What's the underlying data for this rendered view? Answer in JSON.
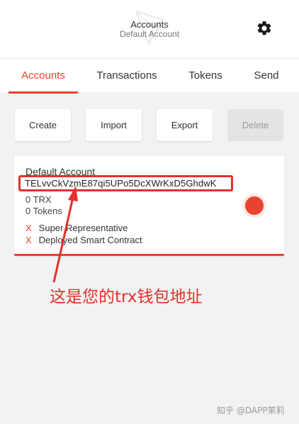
{
  "header": {
    "title": "Accounts",
    "subtitle": "Default Account",
    "settings_icon": "gear-icon"
  },
  "tabs": [
    {
      "label": "Accounts",
      "active": true
    },
    {
      "label": "Transactions",
      "active": false
    },
    {
      "label": "Tokens",
      "active": false
    },
    {
      "label": "Send",
      "active": false
    }
  ],
  "actions": {
    "create": "Create",
    "import": "Import",
    "export": "Export",
    "delete": "Delete"
  },
  "account": {
    "name": "Default Account",
    "address": "TELvvCkVzmE87qi5UPo5DcXWrKxD5GhdwK",
    "trx": "0 TRX",
    "tokens": "0 Tokens",
    "features": [
      {
        "mark": "X",
        "label": "Super Representative"
      },
      {
        "mark": "X",
        "label": "Deployed Smart Contract"
      }
    ]
  },
  "annotation": "这是您的trx钱包地址",
  "watermark": "知乎 @DAPP茉莉",
  "colors": {
    "accent": "#e8432f",
    "annotation": "#e3302a"
  }
}
